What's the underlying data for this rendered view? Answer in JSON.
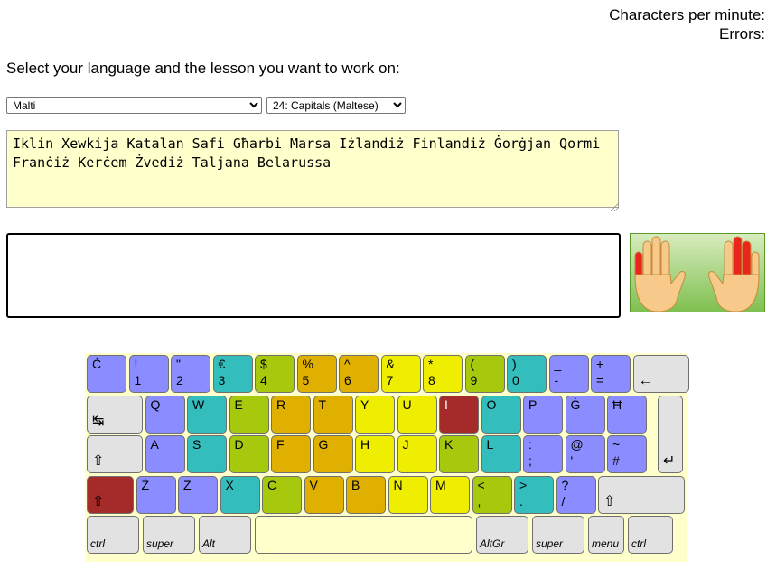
{
  "stats": {
    "cpm_label": "Characters per minute:",
    "errors_label": "Errors:"
  },
  "prompt": "Select your language and the lesson you want to work on:",
  "language_select": {
    "selected": "Malti"
  },
  "lesson_select": {
    "selected": "24: Capitals (Maltese)"
  },
  "lesson_text": "Iklin Xewkija Katalan Safi Għarbi Marsa Iżlandiż Finlandiż Ġorġjan Qormi Franċiż Kerċem Żvediż Taljana Belarussa",
  "typing_area": {
    "value": ""
  },
  "hands_image": {
    "highlighted_fingers": [
      "left-little",
      "right-middle"
    ],
    "highlight_color": "#e8261e"
  },
  "colors": {
    "blue": "#8a8cff",
    "teal": "#33bdbd",
    "green": "#a6c90e",
    "gold": "#dfb000",
    "yellow": "#f0ee00",
    "red": "#a52a2a",
    "gray": "#e2e2e2",
    "keyboard_bg": "#ffffcc",
    "space": "#ffffcc"
  },
  "keyboard": {
    "row1": [
      {
        "top": "Ċ",
        "bot": "",
        "color": "blue"
      },
      {
        "top": "!",
        "bot": "1",
        "color": "blue"
      },
      {
        "top": "\"",
        "bot": "2",
        "color": "blue"
      },
      {
        "top": "€",
        "bot": "3",
        "color": "teal"
      },
      {
        "top": "$",
        "bot": "4",
        "color": "green"
      },
      {
        "top": "%",
        "bot": "5",
        "color": "gold"
      },
      {
        "top": "^",
        "bot": "6",
        "color": "gold"
      },
      {
        "top": "&",
        "bot": "7",
        "color": "yellow"
      },
      {
        "top": "*",
        "bot": "8",
        "color": "yellow"
      },
      {
        "top": "(",
        "bot": "9",
        "color": "green"
      },
      {
        "top": ")",
        "bot": "0",
        "color": "teal"
      },
      {
        "top": "_",
        "bot": "-",
        "color": "blue"
      },
      {
        "top": "+",
        "bot": "=",
        "color": "blue"
      },
      {
        "sym": "←",
        "color": "gray",
        "icon": "backspace-icon"
      }
    ],
    "row2": [
      {
        "sym": "↹",
        "color": "gray",
        "icon": "tab-icon"
      },
      {
        "top": "Q",
        "color": "blue"
      },
      {
        "top": "W",
        "color": "teal"
      },
      {
        "top": "E",
        "color": "green"
      },
      {
        "top": "R",
        "color": "gold"
      },
      {
        "top": "T",
        "color": "gold"
      },
      {
        "top": "Y",
        "color": "yellow"
      },
      {
        "top": "U",
        "color": "yellow"
      },
      {
        "top": "I",
        "color": "red",
        "text_color": "#ffffff"
      },
      {
        "top": "O",
        "color": "teal"
      },
      {
        "top": "P",
        "color": "blue"
      },
      {
        "top": "Ġ",
        "color": "blue"
      },
      {
        "top": "Ħ",
        "color": "blue"
      }
    ],
    "row3": [
      {
        "sym": "⇧",
        "color": "gray",
        "icon": "caps-lock-icon"
      },
      {
        "top": "A",
        "color": "blue"
      },
      {
        "top": "S",
        "color": "teal"
      },
      {
        "top": "D",
        "color": "green"
      },
      {
        "top": "F",
        "color": "gold"
      },
      {
        "top": "G",
        "color": "gold"
      },
      {
        "top": "H",
        "color": "yellow"
      },
      {
        "top": "J",
        "color": "yellow"
      },
      {
        "top": "K",
        "color": "green"
      },
      {
        "top": "L",
        "color": "teal"
      },
      {
        "top": ":",
        "bot": ";",
        "color": "blue"
      },
      {
        "top": "@",
        "bot": "'",
        "color": "blue"
      },
      {
        "top": "~",
        "bot": "#",
        "color": "blue"
      }
    ],
    "enter": {
      "sym": "↵",
      "color": "gray",
      "icon": "enter-icon"
    },
    "row4": [
      {
        "sym": "⇧",
        "color": "red",
        "icon": "left-shift-icon"
      },
      {
        "top": "Ż",
        "color": "blue"
      },
      {
        "top": "Z",
        "color": "blue"
      },
      {
        "top": "X",
        "color": "teal"
      },
      {
        "top": "C",
        "color": "green"
      },
      {
        "top": "V",
        "color": "gold"
      },
      {
        "top": "B",
        "color": "gold"
      },
      {
        "top": "N",
        "color": "yellow"
      },
      {
        "top": "M",
        "color": "yellow"
      },
      {
        "top": "<",
        "bot": ",",
        "color": "green"
      },
      {
        "top": ">",
        "bot": ".",
        "color": "teal"
      },
      {
        "top": "?",
        "bot": "/",
        "color": "blue"
      },
      {
        "sym": "⇧",
        "color": "gray",
        "icon": "right-shift-icon"
      }
    ],
    "row5": [
      {
        "mod": "ctrl",
        "color": "gray"
      },
      {
        "mod": "super",
        "color": "gray"
      },
      {
        "mod": "Alt",
        "color": "gray"
      },
      {
        "mod": "",
        "color": "space"
      },
      {
        "mod": "AltGr",
        "color": "gray"
      },
      {
        "mod": "super",
        "color": "gray"
      },
      {
        "mod": "menu",
        "color": "gray"
      },
      {
        "mod": "ctrl",
        "color": "gray"
      }
    ]
  }
}
